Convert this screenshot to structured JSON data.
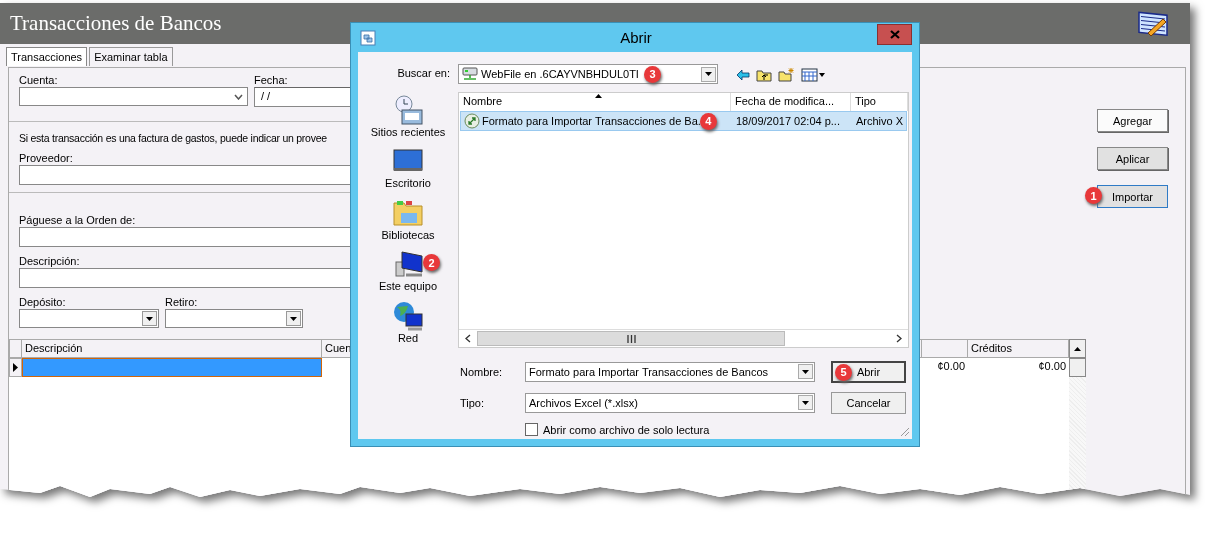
{
  "app": {
    "title": "Transacciones de Bancos"
  },
  "tabs": [
    {
      "label": "Transacciones",
      "selected": true
    },
    {
      "label": "Examinar tabla",
      "selected": false
    }
  ],
  "form": {
    "cuenta": {
      "label": "Cuenta:"
    },
    "fecha": {
      "label": "Fecha:",
      "value": "/ /"
    },
    "note": "Si esta transacción es una factura de gastos, puede indicar un provee",
    "proveedor": {
      "label": "Proveedor:"
    },
    "paguese": {
      "label": "Páguese a la Orden de:"
    },
    "descripcion": {
      "label": "Descripción:"
    },
    "deposito": {
      "label": "Depósito:"
    },
    "retiro": {
      "label": "Retiro:"
    }
  },
  "buttons": [
    {
      "label": "Agregar",
      "shaded": false,
      "focused": false
    },
    {
      "label": "Aplicar",
      "shaded": true,
      "focused": false
    },
    {
      "label": "Importar",
      "shaded": true,
      "focused": true,
      "callout": "1"
    }
  ],
  "table": {
    "columns": [
      {
        "label": "Descripción"
      },
      {
        "label": "Cuen"
      },
      {
        "label": "Créditos"
      }
    ],
    "rows": [
      {
        "current": true,
        "selected": true,
        "column_3": "¢0.00",
        "creditos": "¢0.00"
      }
    ]
  },
  "dialog": {
    "title": "Abrir",
    "look_in": {
      "label": "Buscar en:",
      "value": "WebFile en .6CAYVNBHDUL0TI",
      "callout": "3"
    },
    "places": [
      {
        "label": "Sitios recientes",
        "kind": "recent"
      },
      {
        "label": "Escritorio",
        "kind": "desktop"
      },
      {
        "label": "Bibliotecas",
        "kind": "libraries"
      },
      {
        "label": "Este equipo",
        "kind": "computer",
        "callout": "2"
      },
      {
        "label": "Red",
        "kind": "network"
      }
    ],
    "file_list": {
      "columns": [
        {
          "label": "Nombre",
          "sorted": true
        },
        {
          "label": "Fecha de modifica...",
          "sorted": false
        },
        {
          "label": "Tipo",
          "sorted": false
        }
      ],
      "rows": [
        {
          "name": "Formato para Importar Transacciones de Ba.",
          "modified": "18/09/2017 02:04 p...",
          "type": "Archivo X",
          "selected": true,
          "callout": "4"
        }
      ]
    },
    "file_name": {
      "label": "Nombre:",
      "value": "Formato para Importar Transacciones de Bancos"
    },
    "file_type": {
      "label": "Tipo:",
      "value": "Archivos Excel (*.xlsx)"
    },
    "read_only": {
      "label": "Abrir como archivo de solo lectura",
      "checked": false
    },
    "buttons": [
      {
        "label": "Abrir",
        "default": true,
        "callout": "5"
      },
      {
        "label": "Cancelar",
        "default": false
      }
    ]
  }
}
